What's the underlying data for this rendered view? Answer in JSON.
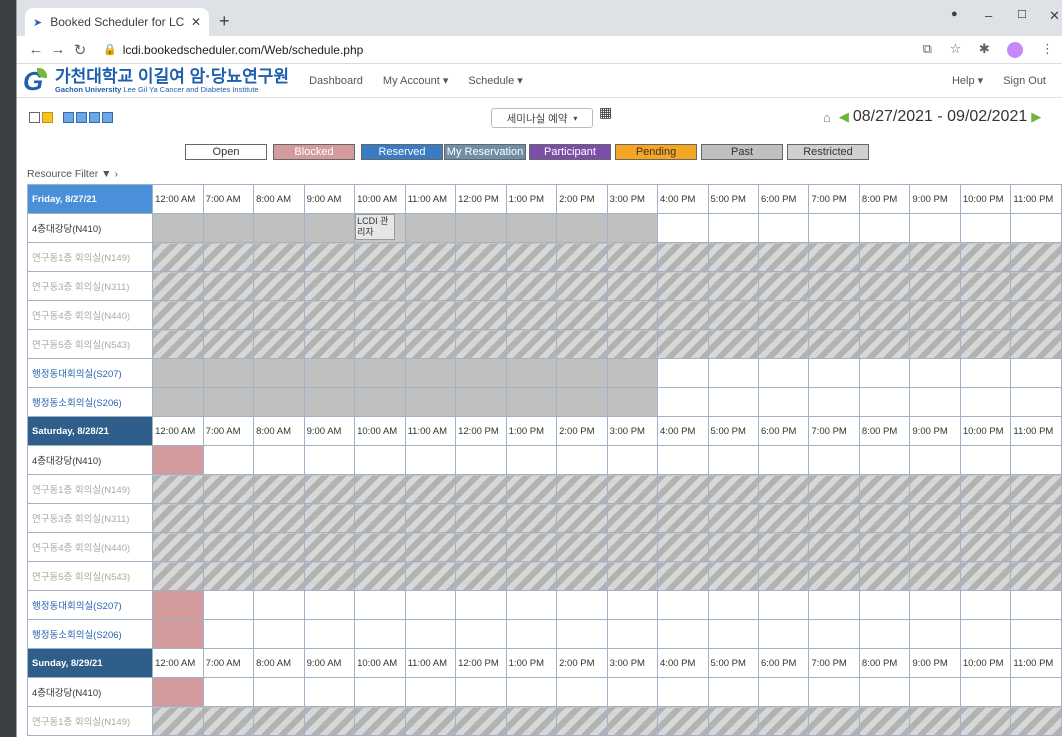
{
  "browser": {
    "tab_title": "Booked Scheduler for LCDI - Sc",
    "url": "lcdi.bookedscheduler.com/Web/schedule.php"
  },
  "nav": {
    "logo_ko": "가천대학교 이길여 암·당뇨연구원",
    "logo_en_univ": "Gachon University",
    "logo_en_inst": "Lee Gil Ya Cancer and Diabetes Institute",
    "dashboard": "Dashboard",
    "my_account": "My Account ▾",
    "schedule": "Schedule ▾",
    "help": "Help ▾",
    "sign_out": "Sign Out"
  },
  "toolbar": {
    "schedule_select": "세미나실 예약",
    "date_range": "08/27/2021 - 09/02/2021"
  },
  "legend": {
    "open": "Open",
    "blocked": "Blocked",
    "reserved": "Reserved",
    "my_reservation": "My Reservation",
    "participant": "Participant",
    "pending": "Pending",
    "past": "Past",
    "restricted": "Restricted"
  },
  "colors": {
    "open": "#ffffff",
    "blocked": "#d39b9b",
    "reserved": "#3a7cc4",
    "my_reservation": "#6d8fa8",
    "participant": "#7b4fa8",
    "pending": "#f5a623",
    "past": "#c0c0c0",
    "restricted": "#d0d0d0"
  },
  "resource_filter": "Resource Filter",
  "times": [
    "12:00 AM",
    "7:00 AM",
    "8:00 AM",
    "9:00 AM",
    "10:00 AM",
    "11:00 AM",
    "12:00 PM",
    "1:00 PM",
    "2:00 PM",
    "3:00 PM",
    "4:00 PM",
    "5:00 PM",
    "6:00 PM",
    "7:00 PM",
    "8:00 PM",
    "9:00 PM",
    "10:00 PM",
    "11:00 PM"
  ],
  "days": [
    {
      "label": "Friday, 8/27/21"
    },
    {
      "label": "Saturday, 8/28/21"
    },
    {
      "label": "Sunday, 8/29/21"
    }
  ],
  "resources": [
    {
      "name": "4층대강당(N410)",
      "style": "normal"
    },
    {
      "name": "연구동1층 회의실(N149)",
      "style": "disabled"
    },
    {
      "name": "연구동3층 회의실(N311)",
      "style": "disabled"
    },
    {
      "name": "연구동4층 회의실(N440)",
      "style": "disabled"
    },
    {
      "name": "연구동5층 회의실(N543)",
      "style": "disabled"
    },
    {
      "name": "행정동대회의실(S207)",
      "style": "link"
    },
    {
      "name": "행정동소회의실(S206)",
      "style": "link"
    }
  ],
  "reservation_label": "LCDI 관리자"
}
